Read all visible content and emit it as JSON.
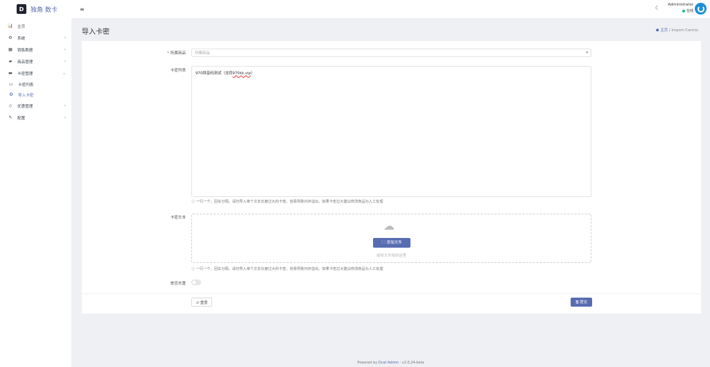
{
  "brand": {
    "logo_letter": "D",
    "title": "独角 数卡"
  },
  "sidebar": {
    "items": [
      {
        "label": "主页",
        "icon": "chart-icon",
        "glyph": "📊",
        "arrow": ""
      },
      {
        "label": "系统",
        "icon": "gear-icon",
        "glyph": "⚙",
        "arrow": "‹"
      },
      {
        "label": "销售数据",
        "icon": "table-icon",
        "glyph": "▦",
        "arrow": "‹"
      },
      {
        "label": "商品管理",
        "icon": "bag-icon",
        "glyph": "▰",
        "arrow": "‹"
      },
      {
        "label": "卡密管理",
        "icon": "card-icon",
        "glyph": "▬",
        "arrow": "⌄"
      },
      {
        "label": "卡密列表",
        "icon": "list-icon",
        "glyph": "▭",
        "arrow": ""
      },
      {
        "label": "导入卡密",
        "icon": "import-icon",
        "glyph": "✪",
        "arrow": ""
      },
      {
        "label": "优惠管理",
        "icon": "diamond-icon",
        "glyph": "◇",
        "arrow": "‹"
      },
      {
        "label": "配置",
        "icon": "wrench-icon",
        "glyph": "✎",
        "arrow": "‹"
      }
    ]
  },
  "topbar": {
    "menu_glyph": "≡",
    "moon_glyph": "☾",
    "user_name": "Administrator",
    "user_status": "在线"
  },
  "page": {
    "title": "导入卡密"
  },
  "breadcrumb": {
    "home": "主页",
    "sep": "/",
    "current": "Import-Carmis",
    "home_glyph": "☗"
  },
  "form": {
    "goods_label": "* 所属商品",
    "goods_placeholder": "所属商品",
    "caret": "▾",
    "carmis_label": "卡密列表",
    "carmis_value_prefix": "970拼音码测试（含同",
    "carmis_value_underlined": "970kk.vip",
    "carmis_value_suffix": "）",
    "help_text": "ⓘ 一行一个，回车分隔。请勿导入单个文本长度过大的卡密，容易导致内存溢出。如果卡密过大建议修改商品为人工处理",
    "file_label": "卡密文本",
    "cloud_glyph": "☁",
    "add_file_label": "🗀 添加文件",
    "drop_hint": "或将文件拖到这里",
    "file_help_text": "ⓘ 一行一个，回车分隔。请勿导入单个文本长度过大的卡密，容易导致内存溢出。如果卡密过大建议修改商品为人工处理",
    "dedupe_label": "是否去重",
    "dedupe_on": false,
    "reset_label": "↺ 重置",
    "submit_label": "🖫 提交"
  },
  "footer": {
    "prefix": "Powered by ",
    "link": "Dcat Admin",
    "suffix": " · v2.0.24-beta"
  },
  "colors": {
    "accent": "#586cb1",
    "online": "#21b978",
    "avatar": "#1e8fd6"
  }
}
